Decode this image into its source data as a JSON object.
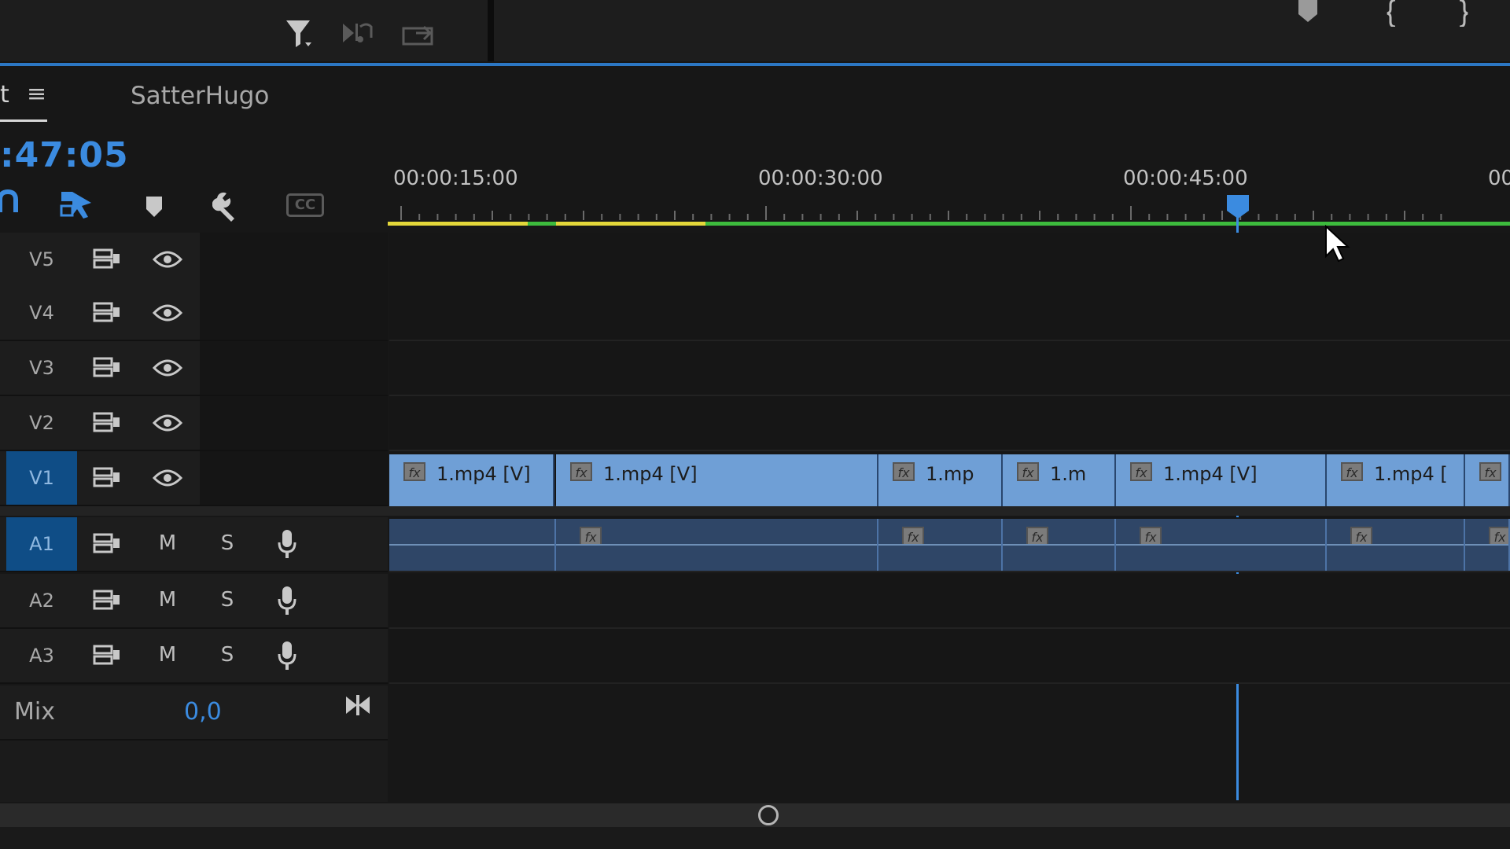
{
  "top_toolbar": {
    "icons": [
      "filter-icon",
      "insert-icon",
      "export-frame-icon"
    ],
    "right_icons": [
      "marker-icon",
      "mark-in-icon",
      "mark-out-icon"
    ]
  },
  "panel": {
    "tab_fragment": "t",
    "menu_label": "≡",
    "sequence_name": "SatterHugo",
    "timecode": ":47:05"
  },
  "tools": {
    "cc_label": "CC"
  },
  "ruler": {
    "labels": [
      "00:00:15:00",
      "00:00:30:00",
      "00:00:45:00",
      "00"
    ]
  },
  "video_tracks": [
    {
      "name": "V5",
      "active": false
    },
    {
      "name": "V4",
      "active": false
    },
    {
      "name": "V3",
      "active": false
    },
    {
      "name": "V2",
      "active": false
    },
    {
      "name": "V1",
      "active": true
    }
  ],
  "audio_tracks": [
    {
      "name": "A1",
      "mute": "M",
      "solo": "S",
      "active": true
    },
    {
      "name": "A2",
      "mute": "M",
      "solo": "S",
      "active": false
    },
    {
      "name": "A3",
      "mute": "M",
      "solo": "S",
      "active": false
    }
  ],
  "video_clips": [
    {
      "label": "1.mp4 [V]"
    },
    {
      "label": "1.mp4 [V]"
    },
    {
      "label": "1.mp"
    },
    {
      "label": "1.m"
    },
    {
      "label": "1.mp4 [V]"
    },
    {
      "label": "1.mp4 ["
    },
    {
      "label": ""
    }
  ],
  "mix": {
    "label": "Mix",
    "value": "0,0"
  },
  "colors": {
    "accent": "#3b8be0",
    "video_clip": "#6f9fd6",
    "audio_clip": "#2f4667",
    "render_yellow": "#e3d73a",
    "render_green": "#3dbb3d"
  }
}
